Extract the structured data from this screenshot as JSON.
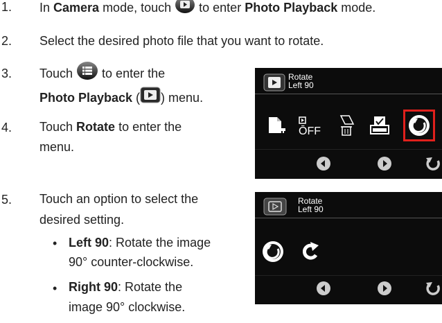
{
  "steps": [
    {
      "number": "1.",
      "parts": [
        "In ",
        "Camera",
        " mode, touch ",
        " to enter ",
        "Photo Playback",
        " mode."
      ]
    },
    {
      "number": "2.",
      "text": "Select the desired photo file that you want to rotate."
    },
    {
      "number": "3.",
      "line1a": "Touch ",
      "line1b": " to enter the",
      "line2a": "Photo Playback",
      "line2b": " (",
      "line2c": ") menu."
    },
    {
      "number": "4.",
      "line1a": "Touch ",
      "line1b": "Rotate",
      "line1c": " to enter the",
      "line2": "menu."
    },
    {
      "number": "5.",
      "line1": "Touch an option to select the",
      "line2": "desired setting."
    }
  ],
  "bullets": [
    {
      "label": "Left 90",
      "rest": ": Rotate the image",
      "line2": "90° counter-clockwise."
    },
    {
      "label": "Right 90",
      "rest": ": Rotate the",
      "line2": "image 90° clockwise."
    }
  ],
  "screen1": {
    "title": "Rotate",
    "subtitle": "Left 90"
  },
  "screen2": {
    "title": "Rotate",
    "subtitle": "Left 90"
  },
  "highlight_color": "#e0201c"
}
